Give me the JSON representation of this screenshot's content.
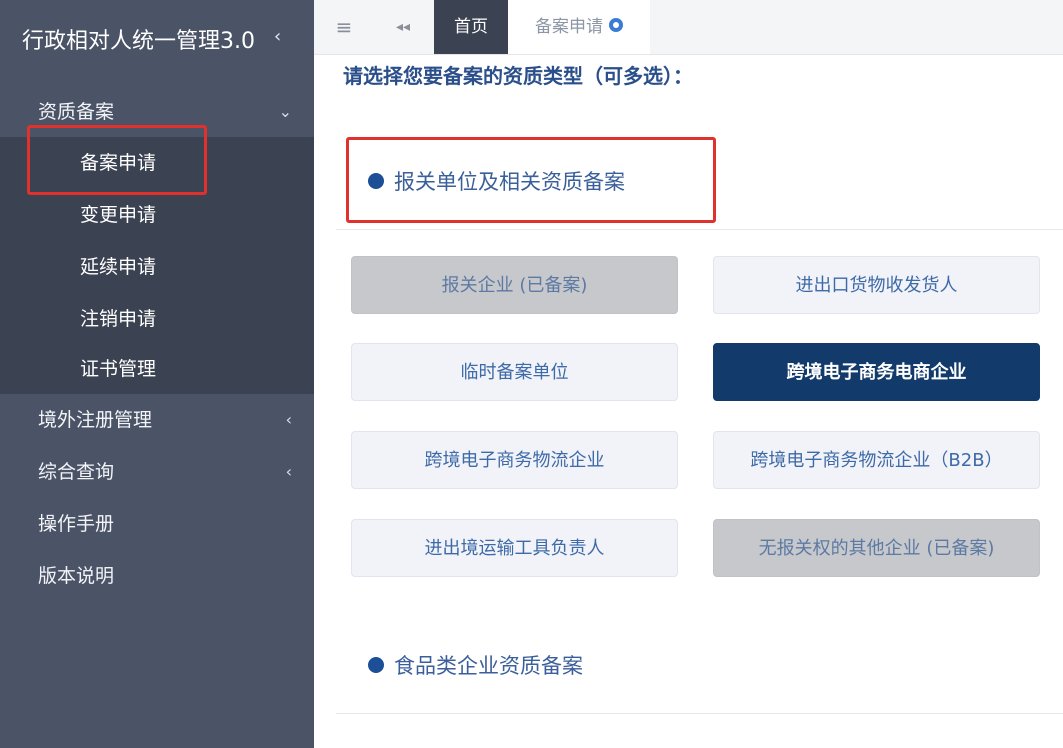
{
  "sidebar": {
    "app_title": "行政相对人统一管理3.0",
    "menu": [
      {
        "label": "资质备案",
        "chevron": "⌄"
      },
      {
        "label": "境外注册管理",
        "chevron": "‹"
      },
      {
        "label": "综合查询",
        "chevron": "‹"
      },
      {
        "label": "操作手册"
      },
      {
        "label": "版本说明"
      }
    ],
    "submenu": [
      "备案申请",
      "变更申请",
      "延续申请",
      "注销申请",
      "证书管理"
    ]
  },
  "tabbar": {
    "menu_icon": "≡",
    "back_icon": "◂◂",
    "tabs": [
      {
        "label": "首页"
      },
      {
        "label": "备案申请"
      }
    ]
  },
  "main": {
    "prompt": "请选择您要备案的资质类型（可多选）：",
    "sections": [
      {
        "title": "报关单位及相关资质备案"
      },
      {
        "title": "食品类企业资质备案"
      }
    ],
    "qualifications": [
      {
        "label": "报关企业 (已备案)",
        "state": "disabled"
      },
      {
        "label": "进出口货物收发货人",
        "state": "normal"
      },
      {
        "label": "临时备案单位",
        "state": "normal"
      },
      {
        "label": "跨境电子商务电商企业",
        "state": "selected"
      },
      {
        "label": "跨境电子商务物流企业",
        "state": "normal"
      },
      {
        "label": "跨境电子商务物流企业（B2B）",
        "state": "normal"
      },
      {
        "label": "进出境运输工具负责人",
        "state": "normal"
      },
      {
        "label": "无报关权的其他企业 (已备案)",
        "state": "disabled"
      }
    ]
  },
  "colors": {
    "sidebar_bg": "#4b5366",
    "submenu_bg": "#3b4252",
    "highlight_red": "#e0312d",
    "selected_btn": "#123a6b",
    "accent_blue": "#1c4f96"
  }
}
